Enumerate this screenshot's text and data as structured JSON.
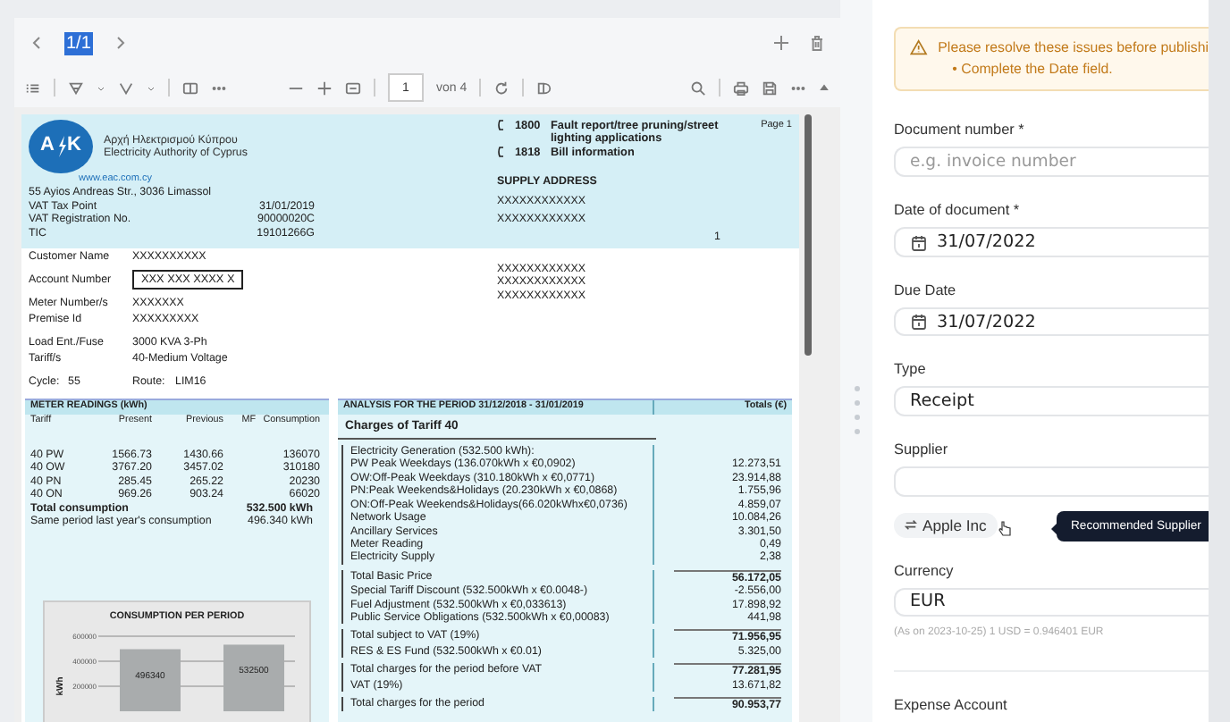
{
  "viewer": {
    "page_label": "1/1",
    "page_input": "1",
    "page_count": "von 4"
  },
  "document": {
    "logo_left": "A",
    "logo_right": "K",
    "org_name_greek": "Αρχή Ηλεκτρισμού Κύπρου",
    "org_name": "Electricity Authority of Cyprus",
    "website": "www.eac.com.cy",
    "phones": [
      {
        "number": "1800",
        "text": "Fault report/tree pruning/street lighting applications"
      },
      {
        "number": "1818",
        "text": "Bill information"
      }
    ],
    "page": "Page 1",
    "address": "55 Ayios Andreas Str., 3036 Limassol",
    "info": [
      {
        "label": "VAT Tax Point",
        "value": "31/01/2019"
      },
      {
        "label": "VAT Registration No.",
        "value": "90000020C"
      },
      {
        "label": "TIC",
        "value": "19101266G"
      }
    ],
    "supply_title": "SUPPLY ADDRESS",
    "supply_lines": [
      "XXXXXXXXXXXX",
      "XXXXXXXXXXXX"
    ],
    "marker": "1",
    "customer": [
      {
        "label": "Customer Name",
        "value": "XXXXXXXXXX",
        "boxed": false
      },
      {
        "label": "Account Number",
        "value": "XXX XXX XXXX X",
        "boxed": true
      },
      {
        "label": "Meter Number/s",
        "value": "XXXXXXX",
        "boxed": false
      },
      {
        "label": "Premise Id",
        "value": "XXXXXXXXX",
        "boxed": false
      }
    ],
    "mailing_lines": [
      "XXXXXXXXXXXX",
      "XXXXXXXXXXXX",
      "XXXXXXXXXXXX"
    ],
    "load": [
      {
        "label": "Load Ent./Fuse",
        "value": "3000 KVA 3-Ph"
      },
      {
        "label": "Tariff/s",
        "value": "40-Medium Voltage"
      }
    ],
    "cycle": {
      "label": "Cycle:",
      "value": "55",
      "route_label": "Route:",
      "route_value": "LIM16"
    },
    "meter": {
      "title": "METER READINGS (kWh)",
      "columns": [
        "Tariff",
        "Present",
        "Previous",
        "MF",
        "Consumption"
      ],
      "rows": [
        [
          "40 PW",
          "1566.73",
          "1430.66",
          "",
          "136070"
        ],
        [
          "40 OW",
          "3767.20",
          "3457.02",
          "",
          "310180"
        ],
        [
          "40 PN",
          "285.45",
          "265.22",
          "",
          "20230"
        ],
        [
          "40 ON",
          "969.26",
          "903.24",
          "",
          "66020"
        ]
      ],
      "total_label": "Total consumption",
      "total_value": "532.500 kWh",
      "last_year_label": "Same period last year's consumption",
      "last_year_value": "496.340 kWh",
      "chart_data": {
        "type": "bar",
        "title": "CONSUMPTION PER PERIOD",
        "ylabel": "kWh",
        "values": [
          496340,
          532500
        ],
        "ylim": [
          0,
          600000
        ],
        "yticks": [
          200000,
          400000,
          600000
        ],
        "data_labels": true
      }
    },
    "analysis": {
      "title": "ANALYSIS FOR THE PERIOD 31/12/2018 - 31/01/2019",
      "totals_title": "Totals (€)",
      "charges_title": "Charges of Tariff 40",
      "groups": [
        {
          "lines": [
            {
              "label": "Electricity Generation (532.500 kWh):"
            },
            {
              "label": "PW Peak Weekdays (136.070kWh x €0,0902)",
              "amount": "12.273,51",
              "bold": false
            },
            {
              "label": "OW:Off-Peak Weekdays (310.180kWh x €0,0771)",
              "amount": "23.914,88",
              "bold": false
            },
            {
              "label": "PN:Peak Weekends&Holidays (20.230kWh x €0,0868)",
              "amount": "1.755,96",
              "bold": false
            },
            {
              "label": "ON:Off-Peak Weekends&Holidays(66.020kWhx€0,0736)",
              "amount": "4.859,07",
              "bold": false
            },
            {
              "label": "Network Usage",
              "amount": "10.084,26",
              "bold": false
            },
            {
              "label": "Ancillary Services",
              "amount": "3.301,50",
              "bold": false
            },
            {
              "label": "Meter Reading",
              "amount": "0,49",
              "bold": false
            },
            {
              "label": "Electricity Supply",
              "amount": "2,38",
              "bold": false
            }
          ]
        },
        {
          "lines": [
            {
              "label": "Total Basic Price",
              "amount": "56.172,05",
              "bold": true
            },
            {
              "label": "Special Tariff Discount (532.500kWh x €0.0048-)",
              "amount": "-2.556,00",
              "bold": false
            },
            {
              "label": "Fuel Adjustment (532.500kWh x €0,033613)",
              "amount": "17.898,92",
              "bold": false
            },
            {
              "label": "Public Service Obligations (532.500kWh x €0,00083)",
              "amount": "441,98",
              "bold": false
            }
          ]
        },
        {
          "lines": [
            {
              "label": "Total subject to VAT (19%)",
              "amount": "71.956,95",
              "bold": true
            },
            {
              "label": "RES & ES Fund (532.500kWh x €0.01)",
              "amount": "5.325,00",
              "bold": false
            }
          ]
        },
        {
          "lines": [
            {
              "label": "Total charges for the period before VAT",
              "amount": "77.281,95",
              "bold": true
            },
            {
              "label": "VAT (19%)",
              "amount": "13.671,82",
              "bold": false
            }
          ]
        },
        {
          "lines": [
            {
              "label": "Total charges for the period",
              "amount": "90.953,77",
              "bold": true
            }
          ]
        }
      ]
    }
  },
  "form": {
    "alert": {
      "title": "Please resolve these issues before publishi",
      "items": [
        {
          "marker": "•",
          "text": "Complete the Date field."
        }
      ]
    },
    "fields": [
      {
        "kind": "text",
        "label": "Document number *",
        "placeholder": "e.g. invoice number"
      },
      {
        "kind": "date",
        "label": "Date of document *",
        "value": "31/07/2022"
      },
      {
        "kind": "date",
        "label": "Due Date",
        "value": "31/07/2022"
      },
      {
        "kind": "select",
        "label": "Type",
        "value": "Receipt"
      },
      {
        "kind": "supplier",
        "label": "Supplier",
        "suggestion": "Apple Inc",
        "tooltip": "Recommended Supplier"
      },
      {
        "kind": "select",
        "label": "Currency",
        "value": "EUR",
        "note": "(As on 2023-10-25) 1 USD = 0.946401 EUR"
      },
      {
        "kind": "divider"
      },
      {
        "kind": "heading",
        "label": "Expense Account"
      }
    ]
  }
}
